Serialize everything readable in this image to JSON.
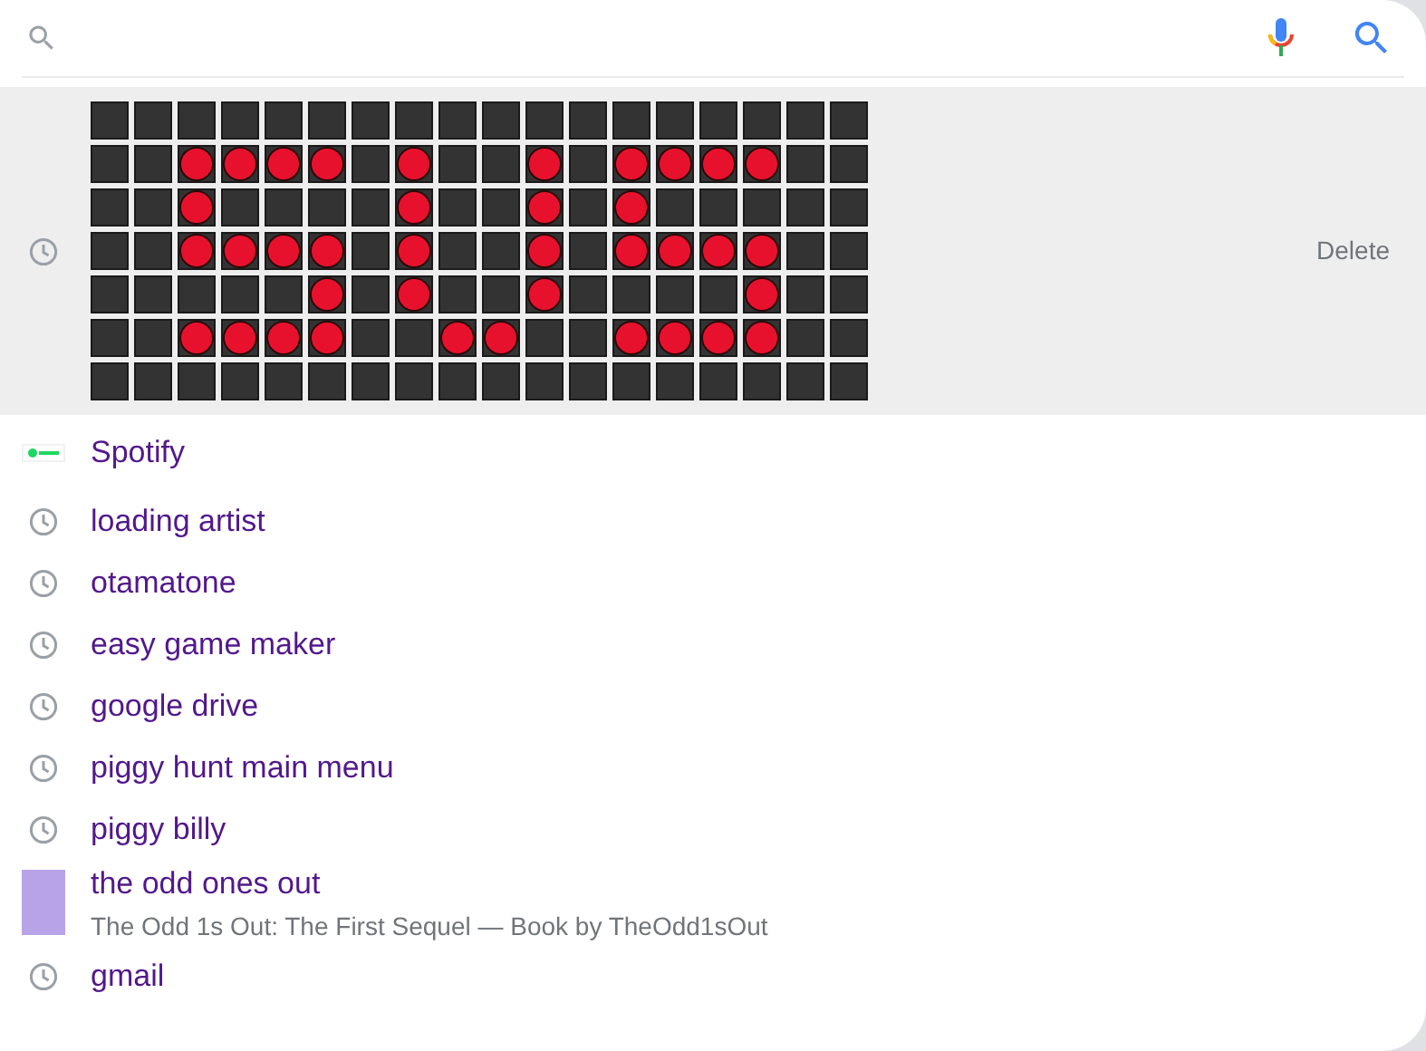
{
  "suggestions": [
    {
      "kind": "grid",
      "selected": true,
      "action": "Delete",
      "grid": [
        [
          false,
          false,
          false,
          false,
          false,
          false,
          false,
          false,
          false,
          false,
          false,
          false,
          false,
          false,
          false,
          false,
          false,
          false
        ],
        [
          false,
          false,
          true,
          true,
          true,
          true,
          false,
          true,
          false,
          false,
          true,
          false,
          true,
          true,
          true,
          true,
          false,
          false
        ],
        [
          false,
          false,
          true,
          false,
          false,
          false,
          false,
          true,
          false,
          false,
          true,
          false,
          true,
          false,
          false,
          false,
          false,
          false
        ],
        [
          false,
          false,
          true,
          true,
          true,
          true,
          false,
          true,
          false,
          false,
          true,
          false,
          true,
          true,
          true,
          true,
          false,
          false
        ],
        [
          false,
          false,
          false,
          false,
          false,
          true,
          false,
          true,
          false,
          false,
          true,
          false,
          false,
          false,
          false,
          true,
          false,
          false
        ],
        [
          false,
          false,
          true,
          true,
          true,
          true,
          false,
          false,
          true,
          true,
          false,
          false,
          true,
          true,
          true,
          true,
          false,
          false
        ],
        [
          false,
          false,
          false,
          false,
          false,
          false,
          false,
          false,
          false,
          false,
          false,
          false,
          false,
          false,
          false,
          false,
          false,
          false
        ]
      ]
    },
    {
      "kind": "logo",
      "selected": false,
      "text": "Spotify"
    },
    {
      "kind": "history",
      "selected": false,
      "text": "loading artist"
    },
    {
      "kind": "history",
      "selected": false,
      "text": "otamatone"
    },
    {
      "kind": "history",
      "selected": false,
      "text": "easy game maker"
    },
    {
      "kind": "history",
      "selected": false,
      "text": "google drive"
    },
    {
      "kind": "history",
      "selected": false,
      "text": "piggy hunt main menu"
    },
    {
      "kind": "history",
      "selected": false,
      "text": "piggy billy"
    },
    {
      "kind": "book",
      "selected": false,
      "text": "the odd ones out",
      "subtitle": "The Odd 1s Out: The First Sequel — Book by TheOdd1sOut"
    },
    {
      "kind": "history",
      "selected": false,
      "text": "gmail"
    }
  ]
}
